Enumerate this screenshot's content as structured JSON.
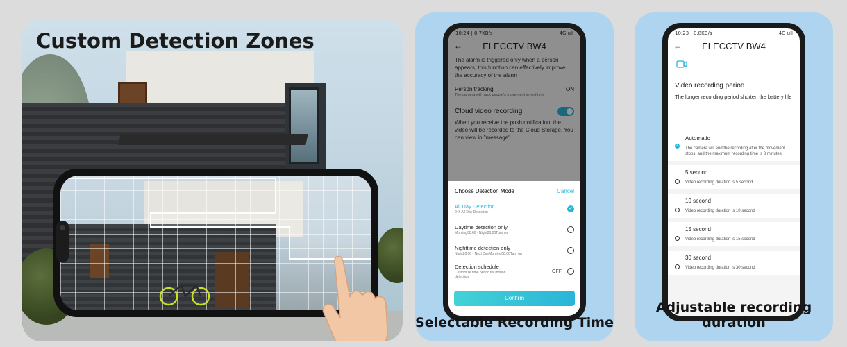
{
  "panel1": {
    "title": "Custom Detection Zones"
  },
  "panel2": {
    "caption": "Selectable Recording Time",
    "status_left": "10:24 | 0.7KB/s",
    "status_right": "4G ull",
    "app_title": "ELECCTV BW4",
    "alarm_text": "The alarm is triggered only when a person appears, this function can effectively improve the accuracy of the alarm",
    "person_tracking_label": "Person tracking",
    "person_tracking_value": "ON",
    "person_tracking_sub": "The camera will track people's movement in real time",
    "cloud_label": "Cloud video recording",
    "cloud_text": "When you receive the push notification, the video will be recorded to the Cloud Storage. You can view in \"message\"",
    "sheet_title": "Choose Detection Mode",
    "cancel_label": "Cancel",
    "options": [
      {
        "title": "All Day Detection",
        "sub": "24h All Day Detection",
        "selected": true
      },
      {
        "title": "Daytime detection only",
        "sub": "Morning08:00 - Night20:00Turn on",
        "selected": false
      },
      {
        "title": "Nighttime detection only",
        "sub": "Night20:00 - Next DayMorning08:00Turn on",
        "selected": false
      },
      {
        "title": "Detection schedule",
        "sub": "Customize time period for motion detection",
        "value": "OFF",
        "selected": false
      }
    ],
    "confirm_label": "Confirm",
    "accent": "#2ab5d8"
  },
  "panel3": {
    "caption": "Adjustable recording duration",
    "status_left": "10:23 | 0.8KB/s",
    "status_right": "4G ull",
    "app_title": "ELECCTV BW4",
    "heading": "Video recording period",
    "description": "The longer recording period shorten the battery life",
    "items": [
      {
        "title": "Automatic",
        "sub": "The camera will end the recording after the movement stops, and the maximum recording time is 3 minutes",
        "selected": true
      },
      {
        "title": "5 second",
        "sub": "Video recording duration is 5 second",
        "selected": false
      },
      {
        "title": "10 second",
        "sub": "Video recording duration is 10 second",
        "selected": false
      },
      {
        "title": "15 second",
        "sub": "Video recording duration is 15 second",
        "selected": false
      },
      {
        "title": "30 second",
        "sub": "Video recording duration is 30 second",
        "selected": false
      }
    ]
  }
}
